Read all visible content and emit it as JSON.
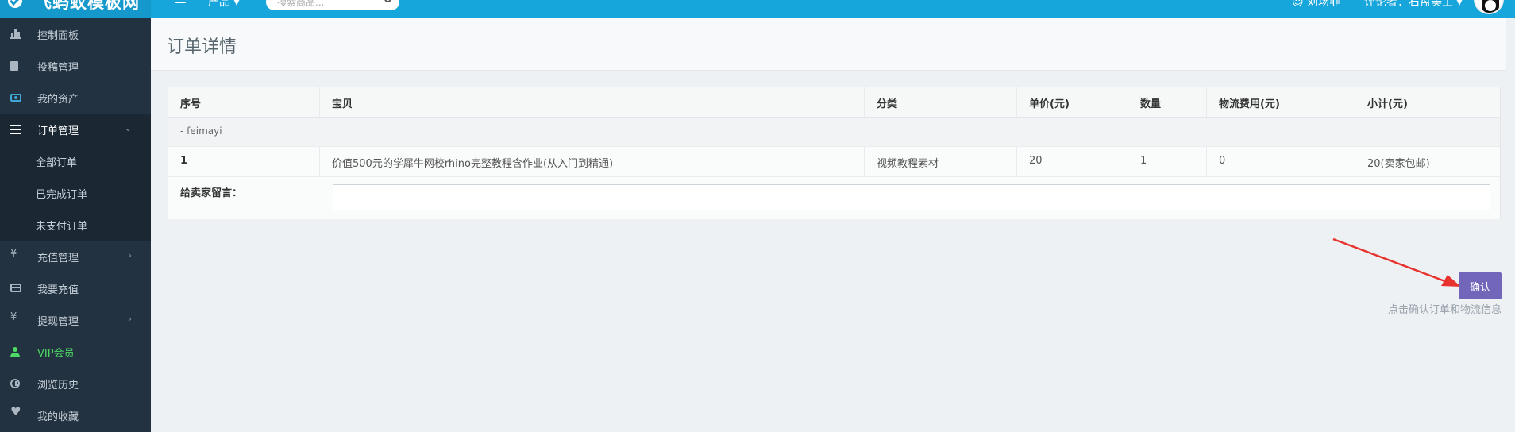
{
  "brand": {
    "name": "飞蚂蚁模板网"
  },
  "topbar": {
    "menu_icon": "menu-icon",
    "product_label": "产品 ▾",
    "search_placeholder": "搜索商品...",
    "user_label": "☺ 刘场非",
    "seller_label": "评论者：石盘美主 ▾",
    "accent_color": "#17a6db"
  },
  "sidebar": {
    "items": [
      {
        "label": "控制面板",
        "icon": "bar-chart-icon"
      },
      {
        "label": "投稿管理",
        "icon": "document-icon"
      },
      {
        "label": "我的资产",
        "icon": "money-icon"
      },
      {
        "label": "订单管理",
        "icon": "list-icon",
        "chevron": "⌄",
        "active": true
      },
      {
        "label": "全部订单"
      },
      {
        "label": "已完成订单"
      },
      {
        "label": "未支付订单"
      },
      {
        "label": "充值管理",
        "icon": "yen-icon",
        "chevron": "›"
      },
      {
        "label": "我要充值",
        "icon": "credit-card-icon"
      },
      {
        "label": "提现管理",
        "icon": "yen-icon",
        "chevron": "›"
      },
      {
        "label": "VIP会员",
        "icon": "user-icon"
      },
      {
        "label": "浏览历史",
        "icon": "history-icon"
      },
      {
        "label": "我的收藏",
        "icon": "heart-icon"
      }
    ]
  },
  "page": {
    "title": "订单详情"
  },
  "order": {
    "columns": [
      "序号",
      "宝贝",
      "分类",
      "单价(元)",
      "数量",
      "物流费用(元)",
      "小计(元)"
    ],
    "shop": "- feimayi",
    "rows": [
      [
        "1",
        "价值500元的学犀牛网校rhino完整教程含作业(从入门到精通)",
        "视频教程素材",
        "20",
        "1",
        "0",
        "20(卖家包邮)"
      ]
    ],
    "message_label": "给卖家留言：",
    "message_value": ""
  },
  "actions": {
    "confirm_label": "确认",
    "confirm_hint": "点击确认订单和物流信息",
    "confirm_color": "#7266ba"
  }
}
